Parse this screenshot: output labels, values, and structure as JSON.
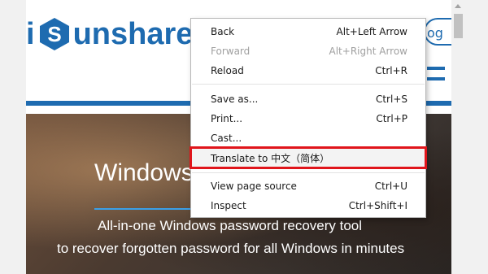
{
  "site": {
    "logo": {
      "prefix": "i",
      "badge_letter": "S",
      "rest": "unshare"
    },
    "header_pill_text": "og",
    "hero": {
      "title": "Windows",
      "line1": "All-in-one Windows password recovery tool",
      "line2": "to recover forgotten password for all Windows in minutes"
    }
  },
  "context_menu": {
    "items": [
      {
        "label": "Back",
        "shortcut": "Alt+Left Arrow",
        "enabled": true
      },
      {
        "label": "Forward",
        "shortcut": "Alt+Right Arrow",
        "enabled": false
      },
      {
        "label": "Reload",
        "shortcut": "Ctrl+R",
        "enabled": true
      },
      {
        "label": "Save as...",
        "shortcut": "Ctrl+S",
        "enabled": true
      },
      {
        "label": "Print...",
        "shortcut": "Ctrl+P",
        "enabled": true
      },
      {
        "label": "Cast...",
        "shortcut": "",
        "enabled": true
      },
      {
        "label": "Translate to 中文（简体）",
        "shortcut": "",
        "enabled": true,
        "highlighted": true
      },
      {
        "label": "View page source",
        "shortcut": "Ctrl+U",
        "enabled": true
      },
      {
        "label": "Inspect",
        "shortcut": "Ctrl+Shift+I",
        "enabled": true
      }
    ]
  },
  "colors": {
    "brand_blue": "#1e6bb0",
    "highlight_border": "#e0151b",
    "hero_rule": "#3aa0e8"
  },
  "icons": {
    "logo_badge": "hexagon-s-logo-icon",
    "menu": "hamburger-menu-icon",
    "scroll_up": "scroll-up-arrow-icon"
  }
}
